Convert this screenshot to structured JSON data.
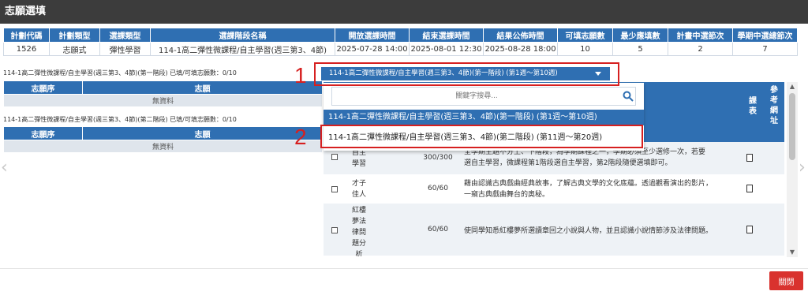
{
  "modal": {
    "title": "志願選填",
    "close_label": "關閉"
  },
  "plan": {
    "headers": [
      "計劃代碼",
      "計劃類型",
      "選課類型",
      "選課階段名稱",
      "開放選課時間",
      "結束選課時間",
      "結果公佈時間",
      "可填志願數",
      "最少應填數",
      "計畫中選節次",
      "學期中選總節次"
    ],
    "row": [
      "1526",
      "志願式",
      "彈性學習",
      "114-1高二彈性微課程/自主學習(週三第3、4節)",
      "2025-07-28 14:00",
      "2025-08-01 12:30",
      "2025-08-28 18:00",
      "10",
      "5",
      "2",
      "7"
    ]
  },
  "stages": [
    {
      "caption": "114-1高二彈性微課程/自主學習(週三第3、4節)(第一階段) 已填/可填志願數：0/10",
      "col1": "志願序",
      "col2": "志願",
      "empty": "無資料"
    },
    {
      "caption": "114-1高二彈性微課程/自主學習(週三第3、4節)(第二階段) 已填/可填志願數：0/10",
      "col1": "志願序",
      "col2": "志願",
      "empty": "無資料"
    }
  ],
  "dropdown": {
    "selected": "114-1高二彈性微課程/自主學習(週三第3、4節)(第一階段) (第1週～第10週)",
    "search_placeholder": "關鍵字搜尋...",
    "options": [
      "114-1高二彈性微課程/自主學習(週三第3、4節)(第一階段) (第1週～第10週)",
      "114-1高二彈性微課程/自主學習(週三第3、4節)(第二階段) (第11週～第20週)"
    ]
  },
  "course_table": {
    "col_syllabus": "課表",
    "col_ref": "參考網址",
    "rows": [
      {
        "name": "自主學習",
        "quota": "300/300",
        "desc_lines": [
          "全學期主題不分上、下階段，為學期課程之一，學期必須至少選修一次，若要",
          "選自主學習，微課程第1階段選自主學習，第2階段隨便選填即可。"
        ]
      },
      {
        "name": "才子佳人",
        "quota": "60/60",
        "desc_lines": [
          "藉由認識古典戲曲經典故事，了解古典文學的文化底蘊。透過觀看演出的影片，",
          "一窺古典戲曲舞台的奧秘。"
        ]
      },
      {
        "name": "紅樓夢法律問題分析",
        "quota": "60/60",
        "desc_lines": [
          "使同學知悉紅樓夢所選讀章回之小說與人物，並且認識小說情節涉及法律問題。"
        ]
      }
    ]
  },
  "annotations": {
    "marker1": "1",
    "marker2": "2",
    "color": "#d62020"
  },
  "colors": {
    "header_blue": "#2f6fb2",
    "close_red": "#d9322e",
    "titlebar": "#3c3c3c"
  }
}
